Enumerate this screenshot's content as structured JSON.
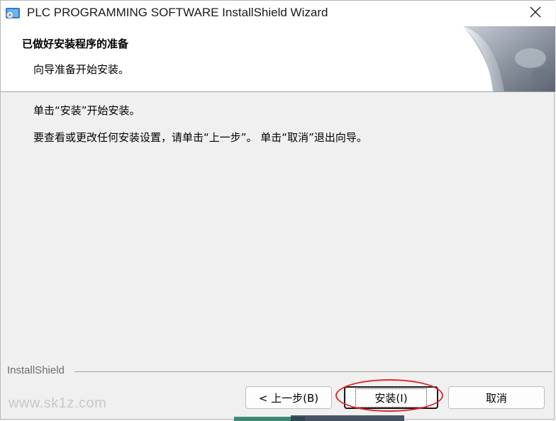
{
  "window": {
    "title": "PLC PROGRAMMING SOFTWARE InstallShield Wizard",
    "close_icon": "close-icon",
    "app_icon": "installer-icon"
  },
  "header": {
    "title": "已做好安装程序的准备",
    "subtitle": "向导准备开始安装。"
  },
  "body": {
    "line1": "单击“安装”开始安装。",
    "line2": "要查看或更改任何安装设置，请单击“上一步”。 单击“取消”退出向导。"
  },
  "footer": {
    "brand": "InstallShield",
    "back_label": "< 上一步(B)",
    "install_label": "安装(I)",
    "cancel_label": "取消"
  },
  "watermark": "www.sk1z.com",
  "colors": {
    "annotation": "#e3262a",
    "background": "#f0f0f0"
  }
}
